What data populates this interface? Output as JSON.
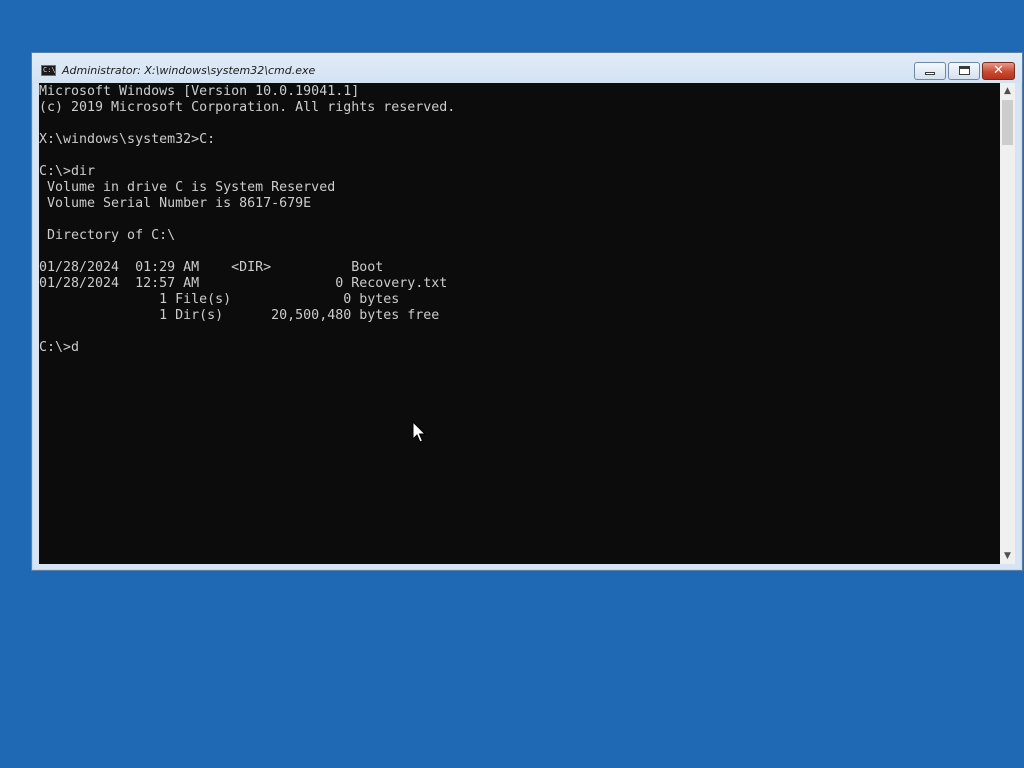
{
  "window": {
    "title": "Administrator: X:\\windows\\system32\\cmd.exe",
    "buttons": {
      "minimize": "minimize-icon",
      "maximize": "restore-icon",
      "close": "close-icon"
    }
  },
  "console": {
    "lines": [
      "Microsoft Windows [Version 10.0.19041.1]",
      "(c) 2019 Microsoft Corporation. All rights reserved.",
      "",
      "X:\\windows\\system32>C:",
      "",
      "C:\\>dir",
      " Volume in drive C is System Reserved",
      " Volume Serial Number is 8617-679E",
      "",
      " Directory of C:\\",
      "",
      "01/28/2024  01:29 AM    <DIR>          Boot",
      "01/28/2024  12:57 AM                 0 Recovery.txt",
      "               1 File(s)              0 bytes",
      "               1 Dir(s)      20,500,480 bytes free",
      "",
      "C:\\>d"
    ]
  },
  "colors": {
    "desktop": "#1f69b4",
    "console_bg": "#0c0c0c",
    "console_fg": "#cccccc"
  }
}
